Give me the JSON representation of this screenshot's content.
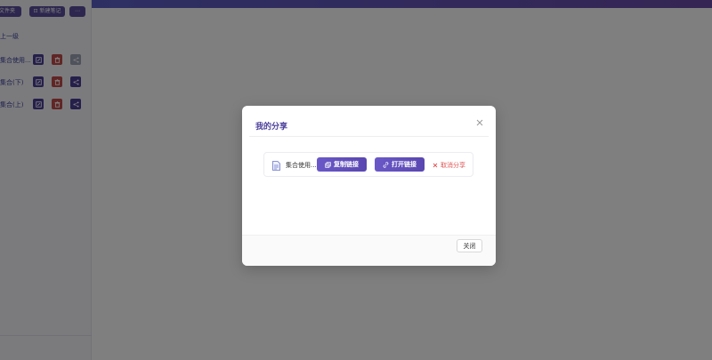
{
  "sidebar": {
    "toolbar": {
      "new_folder": "文件夹",
      "new_note": "新建笔记",
      "more": "⋯"
    },
    "back_label": "上一级",
    "items": [
      {
        "label": "集合使用...",
        "share_disabled": true
      },
      {
        "label": "集合(下)"
      },
      {
        "label": "集合(上)"
      }
    ]
  },
  "modal": {
    "title": "我的分享",
    "item_name": "集合使用...",
    "copy_link": "复制链接",
    "open_link": "打开链接",
    "cancel_share": "取消分享",
    "close_button": "关闭"
  },
  "colors": {
    "accent": "#5a47b0",
    "danger": "#e05555"
  }
}
